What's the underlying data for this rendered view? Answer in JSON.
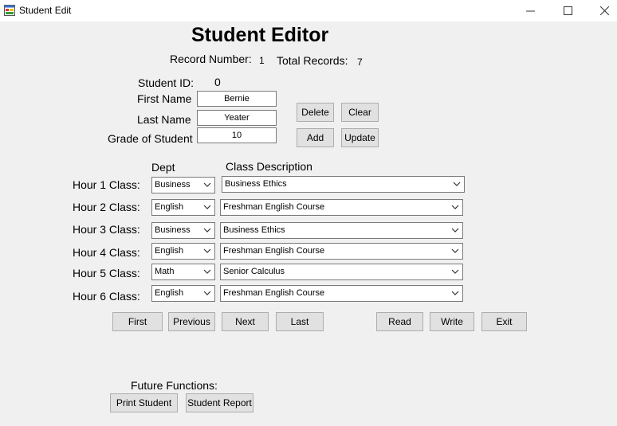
{
  "window": {
    "title": "Student Edit"
  },
  "header": {
    "title": "Student Editor",
    "record_number_label": "Record Number:",
    "record_number_value": "1",
    "total_records_label": "Total Records:",
    "total_records_value": "7"
  },
  "student": {
    "id_label": "Student ID:",
    "id_value": "0",
    "first_name_label": "First Name",
    "first_name_value": "Bernie",
    "last_name_label": "Last Name",
    "last_name_value": "Yeater",
    "grade_label": "Grade of Student",
    "grade_value": "10"
  },
  "edit_buttons": {
    "delete": "Delete",
    "clear": "Clear",
    "add": "Add",
    "update": "Update"
  },
  "classes": {
    "dept_header": "Dept",
    "desc_header": "Class Description",
    "rows": [
      {
        "label": "Hour 1 Class:",
        "dept": "Business",
        "desc": "Business Ethics"
      },
      {
        "label": "Hour 2 Class:",
        "dept": "English",
        "desc": "Freshman English Course"
      },
      {
        "label": "Hour 3 Class:",
        "dept": "Business",
        "desc": "Business Ethics"
      },
      {
        "label": "Hour 4 Class:",
        "dept": "English",
        "desc": "Freshman English Course"
      },
      {
        "label": "Hour 5 Class:",
        "dept": "Math",
        "desc": "Senior Calculus"
      },
      {
        "label": "Hour 6 Class:",
        "dept": "English",
        "desc": "Freshman English Course"
      }
    ]
  },
  "nav_buttons": {
    "first": "First",
    "previous": "Previous",
    "next": "Next",
    "last": "Last",
    "read": "Read",
    "write": "Write",
    "exit": "Exit"
  },
  "future": {
    "label": "Future Functions:",
    "print_student": "Print Student",
    "student_report": "Student Report"
  },
  "icons": {
    "app": "app-form-icon",
    "minimize": "minimize-icon",
    "maximize": "maximize-icon",
    "close": "close-icon",
    "dropdown": "chevron-down-icon"
  }
}
